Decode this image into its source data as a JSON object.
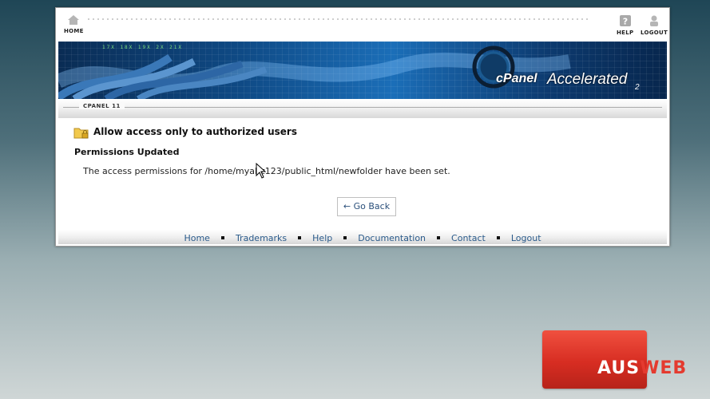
{
  "topbar": {
    "home_label": "HOME",
    "help_label": "HELP",
    "logout_label": "LOGOUT"
  },
  "banner": {
    "ticker": "17X  18X  19X  2X  21X",
    "logo_brand": "cPanel",
    "logo_product": "Accelerated",
    "logo_version": "2"
  },
  "breadcrumb": {
    "label": "CPANEL 11"
  },
  "page": {
    "title": "Allow access only to authorized users",
    "status_heading": "Permissions Updated",
    "message": "The access permissions for /home/myabz123/public_html/newfolder have been set.",
    "go_back_label": "← Go Back"
  },
  "footer": {
    "links": [
      "Home",
      "Trademarks",
      "Help",
      "Documentation",
      "Contact",
      "Logout"
    ]
  },
  "watermark": {
    "part1": "AUS",
    "part2": "WEB"
  },
  "colors": {
    "link": "#2a5a8a",
    "banner": "#0f4a85",
    "watermark": "#d72d22"
  },
  "icons": [
    "home-icon",
    "help-icon",
    "logout-icon",
    "folder-lock-icon",
    "cursor-icon"
  ]
}
